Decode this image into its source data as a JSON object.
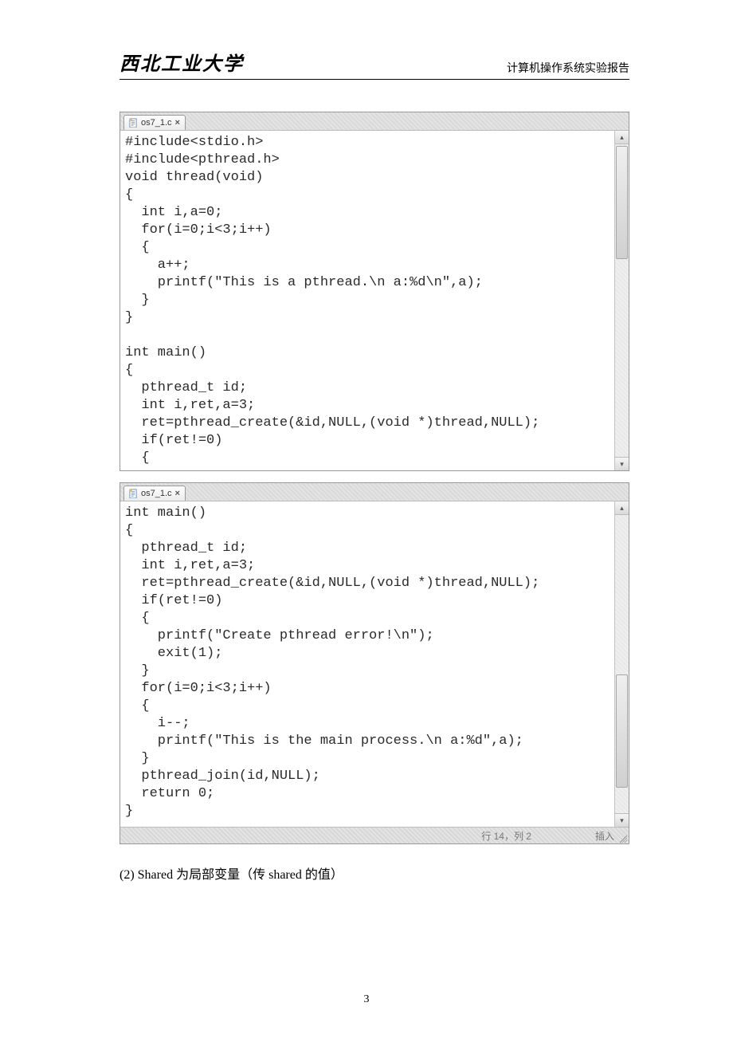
{
  "header": {
    "university": "西北工业大学",
    "report_title": "计算机操作系统实验报告"
  },
  "editor1": {
    "tab": {
      "filename": "os7_1.c",
      "close": "×"
    },
    "code": "#include<stdio.h>\n#include<pthread.h>\nvoid thread(void)\n{\n  int i,a=0;\n  for(i=0;i<3;i++)\n  {\n    a++;\n    printf(\"This is a pthread.\\n a:%d\\n\",a);\n  }\n}\n\nint main()\n{\n  pthread_t id;\n  int i,ret,a=3;\n  ret=pthread_create(&id,NULL,(void *)thread,NULL);\n  if(ret!=0)\n  {"
  },
  "editor2": {
    "tab": {
      "filename": "os7_1.c",
      "close": "×"
    },
    "code": "int main()\n{\n  pthread_t id;\n  int i,ret,a=3;\n  ret=pthread_create(&id,NULL,(void *)thread,NULL);\n  if(ret!=0)\n  {\n    printf(\"Create pthread error!\\n\");\n    exit(1);\n  }\n  for(i=0;i<3;i++)\n  {\n    i--;\n    printf(\"This is the main process.\\n a:%d\",a);\n  }\n  pthread_join(id,NULL);\n  return 0;\n}",
    "status": {
      "pos": "行 14，列 2",
      "mode": "插入"
    }
  },
  "body_line": "(2) Shared 为局部变量（传 shared 的值）",
  "page_number": "3"
}
